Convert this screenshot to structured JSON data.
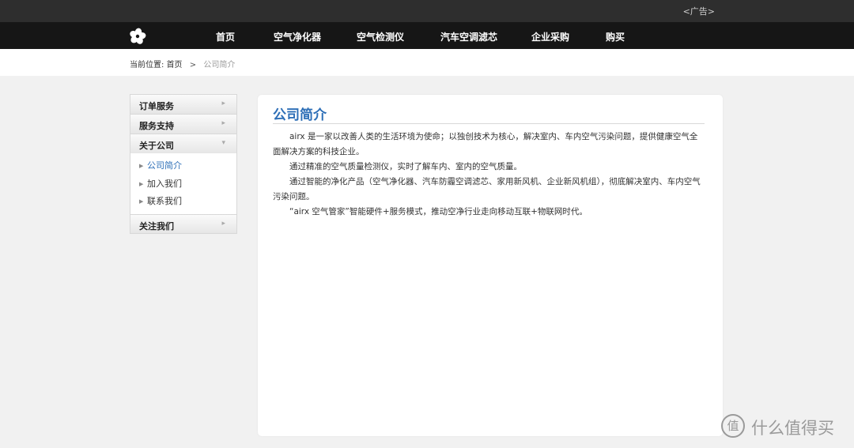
{
  "topbar": {
    "ad_label": "<广告>"
  },
  "nav": {
    "logo_icon": "flower-logo-icon",
    "items": [
      "首页",
      "空气净化器",
      "空气检测仪",
      "汽车空调滤芯",
      "企业采购",
      "购买"
    ]
  },
  "breadcrumb": {
    "prefix": "当前位置:",
    "home": "首页",
    "separator": ">",
    "current": "公司简介"
  },
  "sidebar": {
    "sections": [
      {
        "label": "订单服务"
      },
      {
        "label": "服务支持"
      },
      {
        "label": "关于公司"
      }
    ],
    "about_items": [
      "公司简介",
      "加入我们",
      "联系我们"
    ],
    "follow_label": "关注我们"
  },
  "content": {
    "title": "公司简介",
    "paragraphs": [
      "airx 是一家以改善人类的生活环境为使命；以独创技术为核心，解决室内、车内空气污染问题，提供健康空气全面解决方案的科技企业。",
      "通过精准的空气质量检测仪，实时了解车内、室内的空气质量。",
      "通过智能的净化产品（空气净化器、汽车防霾空调滤芯、家用新风机、企业新风机组），彻底解决室内、车内空气污染问题。",
      "“airx 空气管家”智能硬件+服务模式，推动空净行业走向移动互联+物联网时代。"
    ]
  },
  "watermark": {
    "glyph": "值",
    "text": "什么值得买"
  },
  "colors": {
    "accent": "#2e6fb7",
    "nav_bg": "#161616",
    "topbar_bg": "#2e2e2e",
    "page_bg": "#f1f1f1"
  }
}
